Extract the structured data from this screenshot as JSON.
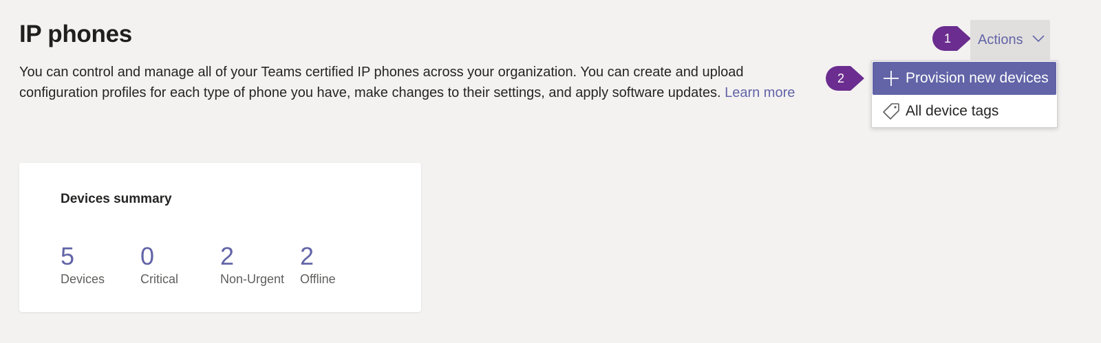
{
  "header": {
    "title": "IP phones",
    "description": "You can control and manage all of your Teams certified IP phones across your organization. You can create and upload configuration profiles for each type of phone you have, make changes to their settings, and apply software updates.",
    "learn_more": "Learn more"
  },
  "actions": {
    "label": "Actions",
    "icon": "chevron-down-icon"
  },
  "callouts": [
    "1",
    "2"
  ],
  "menu": {
    "items": [
      {
        "label": "Provision new devices",
        "icon": "plus-icon"
      },
      {
        "label": "All device tags",
        "icon": "tag-icon"
      }
    ]
  },
  "summary": {
    "title": "Devices summary",
    "stats": [
      {
        "value": "5",
        "label": "Devices"
      },
      {
        "value": "0",
        "label": "Critical"
      },
      {
        "value": "2",
        "label": "Non-Urgent"
      },
      {
        "value": "2",
        "label": "Offline"
      }
    ]
  },
  "colors": {
    "background": "#f3f2f1",
    "accent": "#6264a7",
    "callout": "#6b2d8f"
  }
}
